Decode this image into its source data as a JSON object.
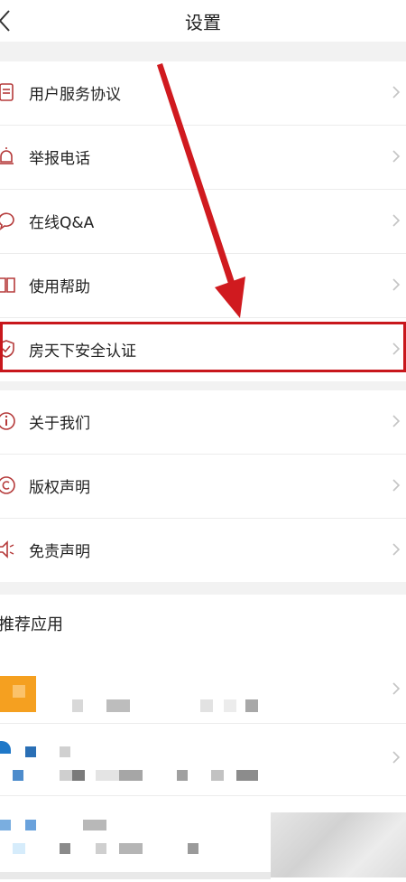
{
  "header": {
    "title": "设置"
  },
  "menu": [
    {
      "label": "用户服务协议",
      "icon": "document-icon"
    },
    {
      "label": "举报电话",
      "icon": "alarm-icon"
    },
    {
      "label": "在线Q&A",
      "icon": "chat-bubble-icon"
    },
    {
      "label": "使用帮助",
      "icon": "book-icon"
    },
    {
      "label": "房天下安全认证",
      "icon": "shield-check-icon",
      "highlighted": true
    },
    {
      "label": "关于我们",
      "icon": "info-icon"
    },
    {
      "label": "版权声明",
      "icon": "copyright-icon"
    },
    {
      "label": "免责声明",
      "icon": "speaker-icon"
    }
  ],
  "recommended": {
    "title": "推荐应用"
  },
  "colors": {
    "accent": "#c8171c",
    "icon": "#b53a3a",
    "app_orange": "#f5a020",
    "app_blue": "#1f78c8"
  }
}
